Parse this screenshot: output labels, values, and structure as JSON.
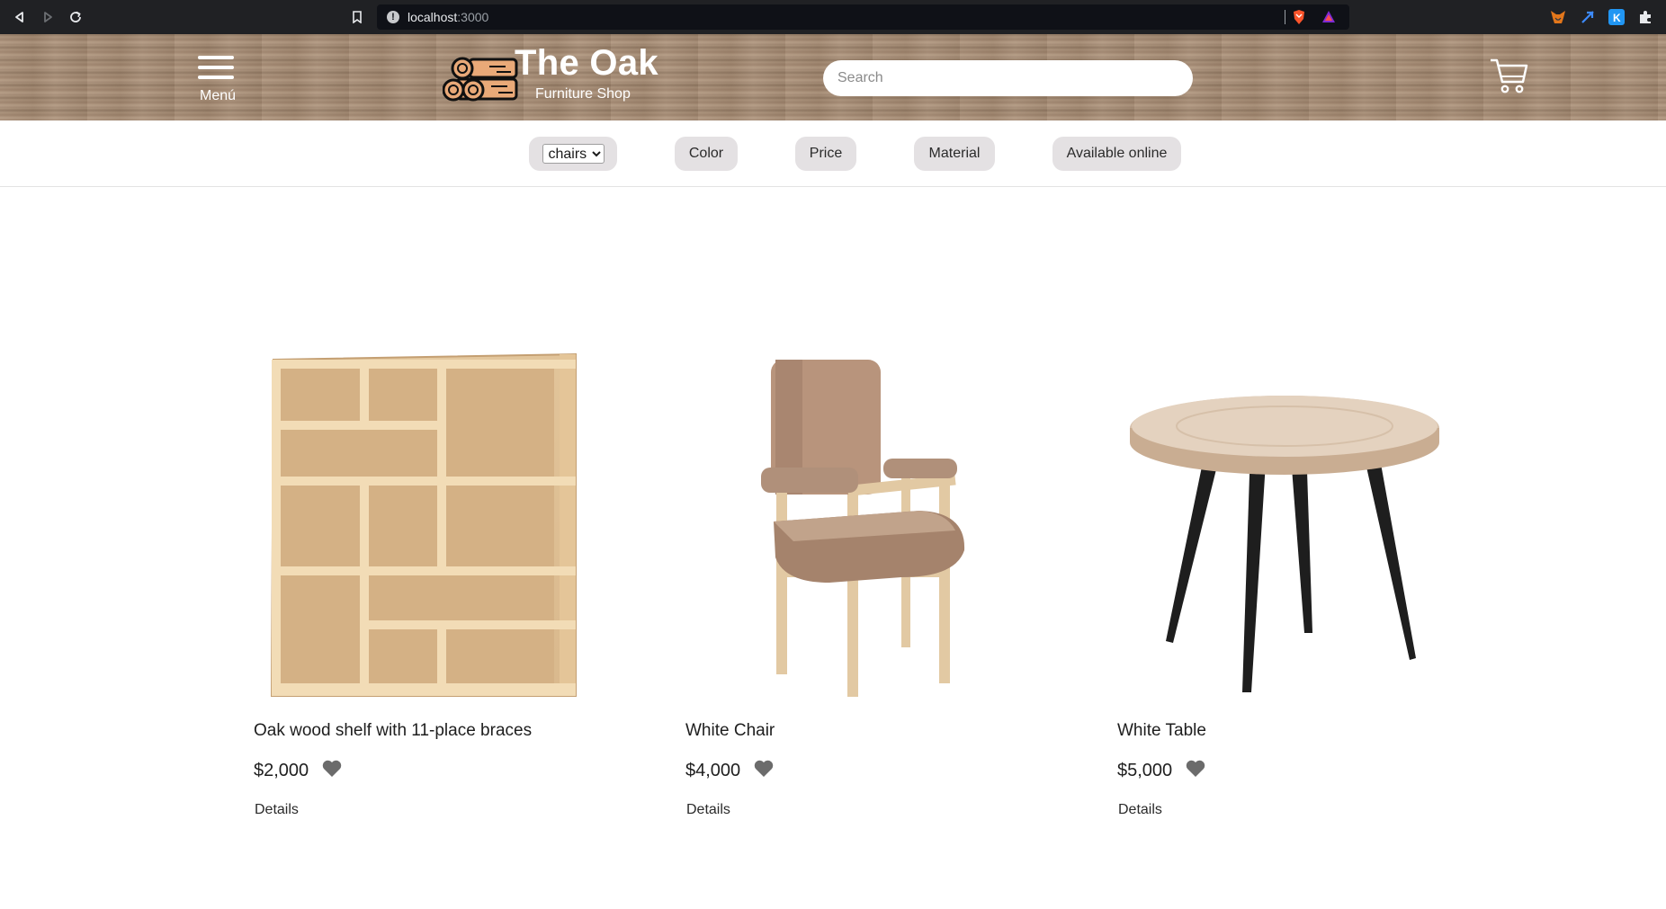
{
  "browser": {
    "url_host": "localhost",
    "url_port": ":3000",
    "nav": {
      "back_icon": "back-arrow-icon",
      "forward_icon": "forward-arrow-icon",
      "reload_icon": "reload-icon"
    },
    "extensions": [
      "metamask-fox-icon",
      "rocket-extension-icon",
      "k-extension-icon",
      "puzzle-extensions-icon"
    ]
  },
  "header": {
    "menu_label": "Menú",
    "brand_title": "The Oak",
    "brand_subtitle": "Furniture Shop",
    "search_placeholder": "Search",
    "cart_icon": "shopping-cart-icon",
    "colors": {
      "text": "#ffffff",
      "wood": "#a08670"
    }
  },
  "filters": {
    "category": {
      "selected": "chairs",
      "options": [
        "chairs"
      ]
    },
    "color_label": "Color",
    "price_label": "Price",
    "material_label": "Material",
    "online_label": "Available online",
    "pill_color": "#e4e1e3"
  },
  "products": [
    {
      "name": "Oak wood shelf with 11-place braces",
      "price": "$2,000",
      "details_label": "Details",
      "image": "bookshelf"
    },
    {
      "name": "White Chair",
      "price": "$4,000",
      "details_label": "Details",
      "image": "armchair"
    },
    {
      "name": "White Table",
      "price": "$5,000",
      "details_label": "Details",
      "image": "round-table"
    }
  ]
}
